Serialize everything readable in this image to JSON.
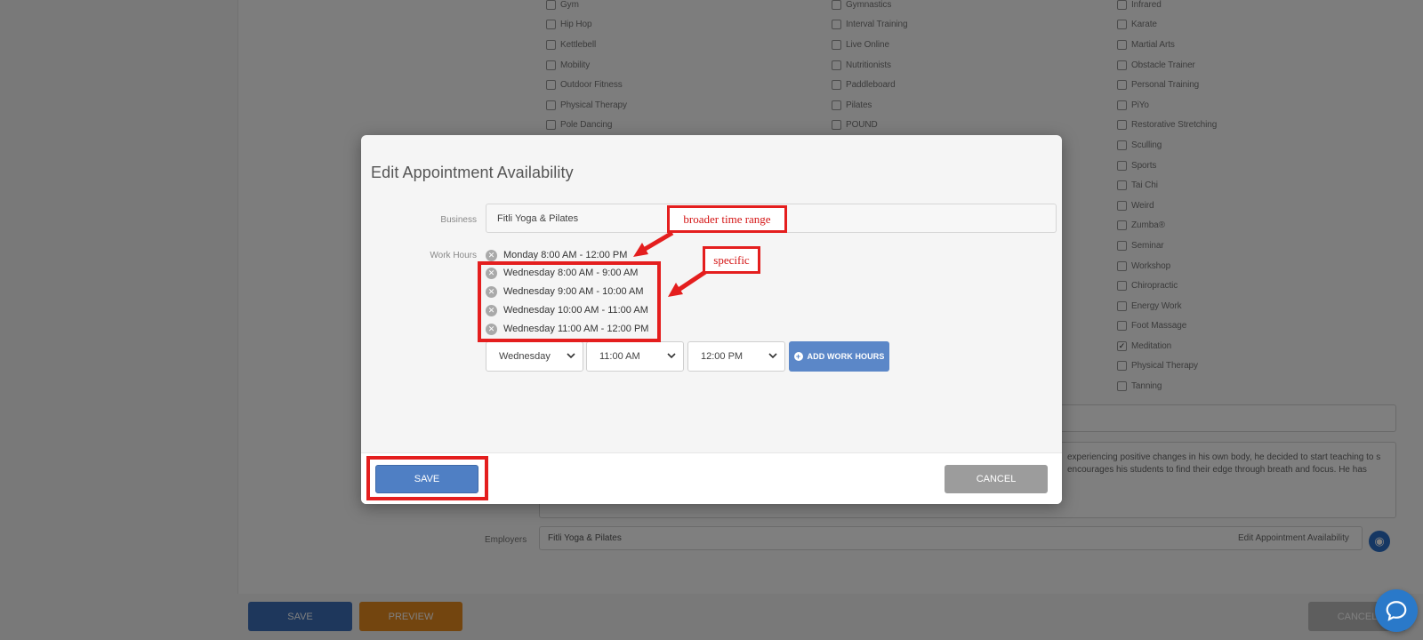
{
  "background": {
    "checkbox_columns": [
      {
        "items": [
          {
            "label": "Gym",
            "checked": false
          },
          {
            "label": "Hip Hop",
            "checked": false
          },
          {
            "label": "Kettlebell",
            "checked": false
          },
          {
            "label": "Mobility",
            "checked": false
          },
          {
            "label": "Outdoor Fitness",
            "checked": false
          },
          {
            "label": "Physical Therapy",
            "checked": false
          },
          {
            "label": "Pole Dancing",
            "checked": false
          }
        ]
      },
      {
        "items": [
          {
            "label": "Gymnastics",
            "checked": false
          },
          {
            "label": "Interval Training",
            "checked": false
          },
          {
            "label": "Live Online",
            "checked": false
          },
          {
            "label": "Nutritionists",
            "checked": false
          },
          {
            "label": "Paddleboard",
            "checked": false
          },
          {
            "label": "Pilates",
            "checked": false
          },
          {
            "label": "POUND",
            "checked": false
          }
        ]
      },
      {
        "items": [
          {
            "label": "Infrared",
            "checked": false
          },
          {
            "label": "Karate",
            "checked": false
          },
          {
            "label": "Martial Arts",
            "checked": false
          },
          {
            "label": "Obstacle Trainer",
            "checked": false
          },
          {
            "label": "Personal Training",
            "checked": false
          },
          {
            "label": "PiYo",
            "checked": false
          },
          {
            "label": "Restorative Stretching",
            "checked": false
          },
          {
            "label": "Sculling",
            "checked": false
          },
          {
            "label": "Sports",
            "checked": false
          },
          {
            "label": "Tai Chi",
            "checked": false
          },
          {
            "label": "Weird",
            "checked": false
          },
          {
            "label": "Zumba®",
            "checked": false
          },
          {
            "label": "Seminar",
            "checked": false
          },
          {
            "label": "Workshop",
            "checked": false
          },
          {
            "label": "Chiropractic",
            "checked": false
          },
          {
            "label": "Energy Work",
            "checked": false
          },
          {
            "label": "Foot Massage",
            "checked": false
          },
          {
            "label": "Meditation",
            "checked": true
          },
          {
            "label": "Physical Therapy",
            "checked": false
          },
          {
            "label": "Tanning",
            "checked": false
          }
        ]
      }
    ],
    "about_text": "experiencing positive changes in his own body, he decided to start teaching to s encourages his students to find their edge through breath and focus. He has",
    "employers_label": "Employers",
    "employers_value": "Fitli Yoga & Pilates",
    "employers_link": "Edit Appointment Availability",
    "save_label": "SAVE",
    "preview_label": "PREVIEW",
    "cancel_label": "CANCEL"
  },
  "modal": {
    "title": "Edit Appointment Availability",
    "business_label": "Business",
    "business_value": "Fitli Yoga & Pilates",
    "work_hours_label": "Work Hours",
    "work_hours": [
      "Monday 8:00 AM - 12:00 PM",
      "Wednesday 8:00 AM - 9:00 AM",
      "Wednesday 9:00 AM - 10:00 AM",
      "Wednesday 10:00 AM - 11:00 AM",
      "Wednesday 11:00 AM - 12:00 PM"
    ],
    "day_select": "Wednesday",
    "start_select": "11:00 AM",
    "end_select": "12:00 PM",
    "add_button": "ADD WORK HOURS",
    "save_button": "SAVE",
    "cancel_button": "CANCEL"
  },
  "annotations": {
    "broader_label": "broader time range",
    "specific_label": "specific",
    "color": "#e41e1e"
  }
}
